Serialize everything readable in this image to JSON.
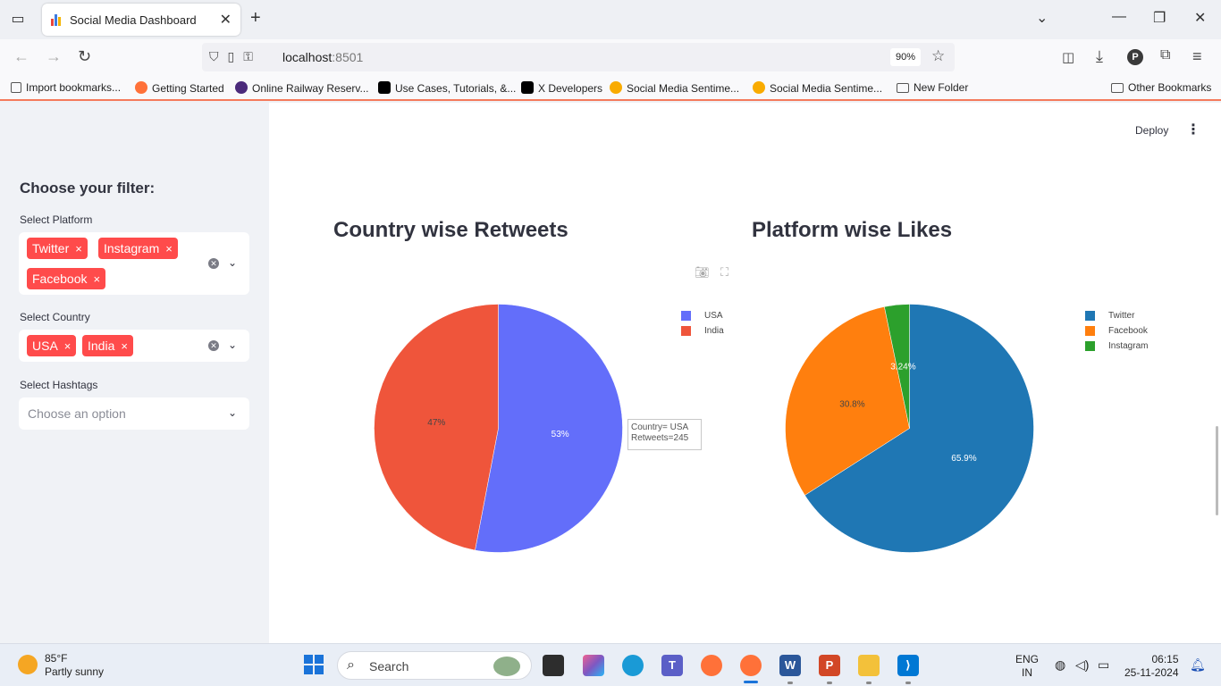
{
  "browser": {
    "tab_title": "Social Media Dashboard",
    "url_host": "localhost",
    "url_port": ":8501",
    "zoom": "90%",
    "bookmarks": [
      "Import bookmarks...",
      "Getting Started",
      "Online Railway Reserv...",
      "Use Cases, Tutorials, &...",
      "X Developers",
      "Social Media Sentime...",
      "Social Media Sentime...",
      "New Folder"
    ],
    "other_bookmarks": "Other Bookmarks"
  },
  "sidebar": {
    "title": "Choose your filter:",
    "platform": {
      "label": "Select Platform",
      "chips": [
        "Twitter",
        "Instagram",
        "Facebook"
      ]
    },
    "country": {
      "label": "Select Country",
      "chips": [
        "USA",
        "India"
      ]
    },
    "hashtags": {
      "label": "Select Hashtags",
      "placeholder": "Choose an option"
    },
    "remove_glyph": "×"
  },
  "main": {
    "deploy_label": "Deploy",
    "tooltip": {
      "line1": "Country= USA",
      "line2": "Retweets=245"
    }
  },
  "chart_data": [
    {
      "type": "pie",
      "title": "Country wise Retweets",
      "labels": [
        "USA",
        "India"
      ],
      "values": [
        53,
        47
      ],
      "value_labels": [
        "53%",
        "47%"
      ],
      "colors": [
        "#636efa",
        "#ef553b"
      ],
      "legend": "top-right"
    },
    {
      "type": "pie",
      "title": "Platform wise Likes",
      "labels": [
        "Twitter",
        "Facebook",
        "Instagram"
      ],
      "values": [
        65.9,
        30.8,
        3.24
      ],
      "value_labels": [
        "65.9%",
        "30.8%",
        "3.24%"
      ],
      "colors": [
        "#1f77b4",
        "#ff7f0e",
        "#2ca02c"
      ],
      "legend": "top-right"
    }
  ],
  "taskbar": {
    "weather_temp": "85°F",
    "weather_desc": "Partly sunny",
    "search_label": "Search",
    "lang_top": "ENG",
    "lang_bottom": "IN",
    "time": "06:15",
    "date": "25-11-2024"
  }
}
